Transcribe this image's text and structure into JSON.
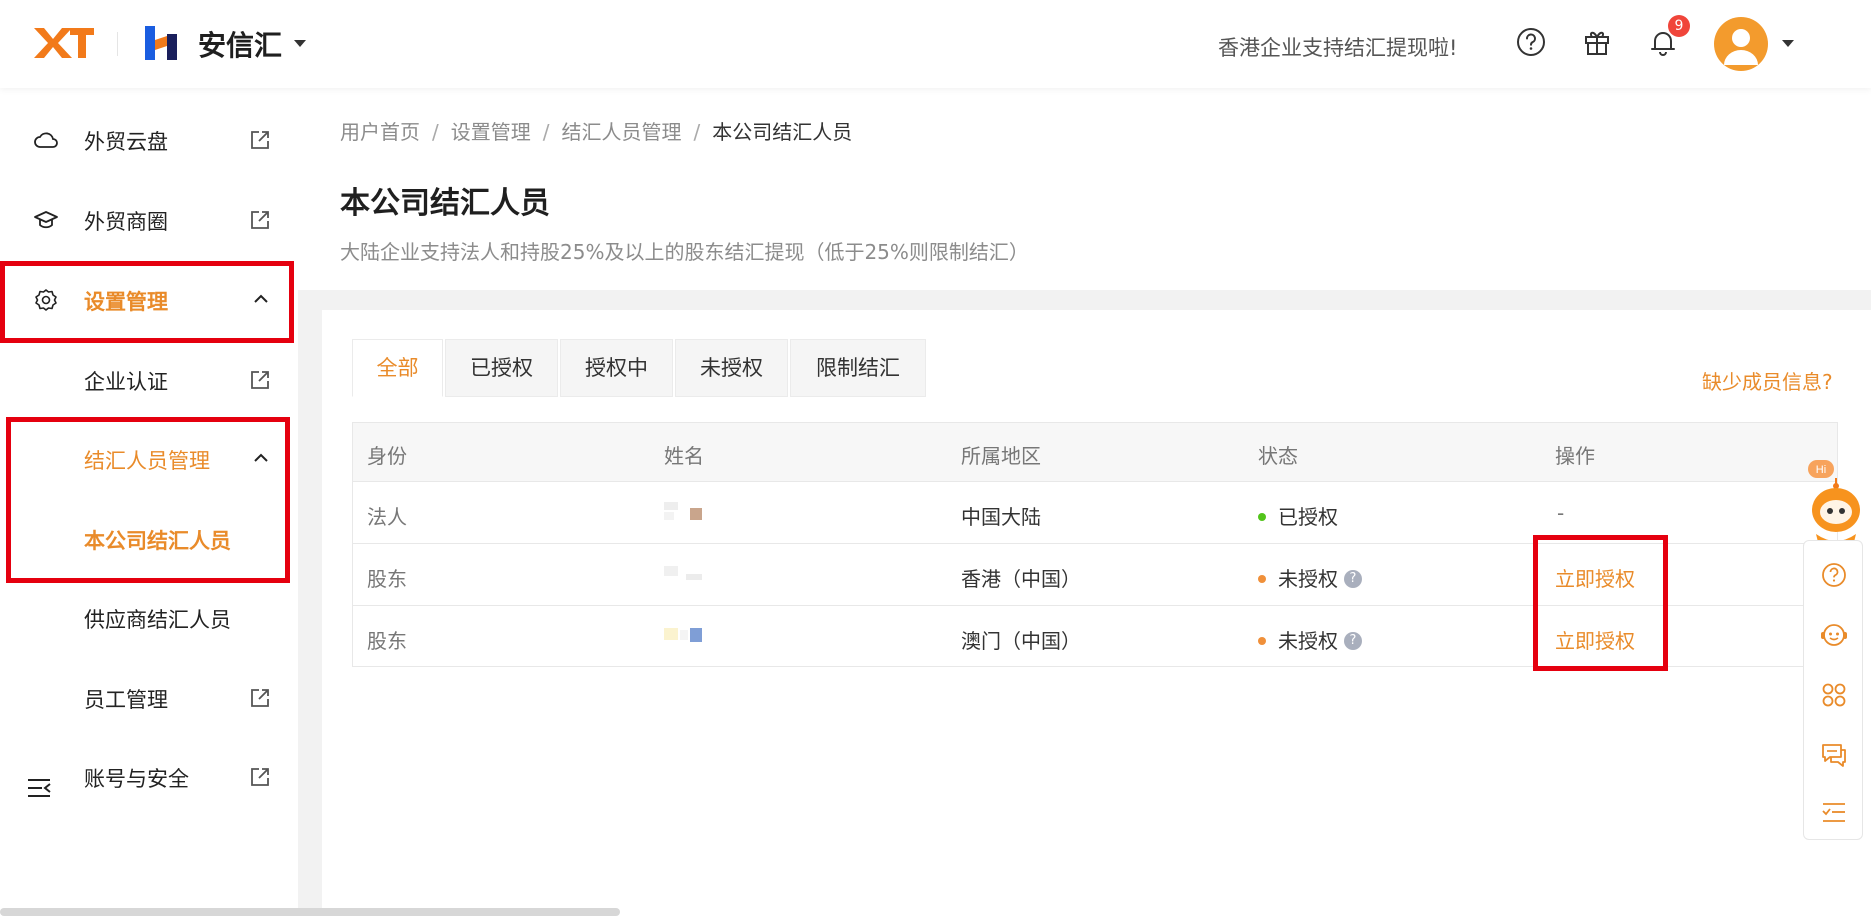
{
  "header": {
    "logo_text": "XT",
    "brand": "安信汇",
    "notice": "香港企业支持结汇提现啦!",
    "notification_count": "9",
    "icons": [
      "help-circle-icon",
      "gift-icon",
      "bell-icon",
      "avatar-icon",
      "caret-down-icon"
    ]
  },
  "sidebar": {
    "items": [
      {
        "label": "外贸云盘",
        "icon": "cloud-icon",
        "external": true
      },
      {
        "label": "外贸商圈",
        "icon": "graduation-cap-icon",
        "external": true
      },
      {
        "label": "设置管理",
        "icon": "settings-icon",
        "expanded": true
      },
      {
        "label": "企业认证",
        "external": true
      },
      {
        "label": "结汇人员管理",
        "expanded": true
      },
      {
        "label": "本公司结汇人员",
        "active": true
      },
      {
        "label": "供应商结汇人员"
      },
      {
        "label": "员工管理",
        "external": true
      },
      {
        "label": "账号与安全",
        "external": true
      }
    ],
    "collapse_icon": "menu-collapse-icon"
  },
  "breadcrumb": [
    "用户首页",
    "设置管理",
    "结汇人员管理",
    "本公司结汇人员"
  ],
  "breadcrumb_sep": "/",
  "page": {
    "title": "本公司结汇人员",
    "description": "大陆企业支持法人和持股25%及以上的股东结汇提现（低于25%则限制结汇）"
  },
  "tabs": [
    {
      "label": "全部",
      "active": true
    },
    {
      "label": "已授权"
    },
    {
      "label": "授权中"
    },
    {
      "label": "未授权"
    },
    {
      "label": "限制结汇"
    }
  ],
  "missing_info_link": "缺少成员信息?",
  "table": {
    "headers": [
      "身份",
      "姓名",
      "所属地区",
      "状态",
      "操作"
    ],
    "rows": [
      {
        "identity": "法人",
        "name": "",
        "region": "中国大陆",
        "status": "已授权",
        "status_color": "#52c41a",
        "status_help": false,
        "action": "-"
      },
      {
        "identity": "股东",
        "name": "",
        "region": "香港（中国）",
        "status": "未授权",
        "status_color": "#f0903a",
        "status_help": true,
        "action": "立即授权"
      },
      {
        "identity": "股东",
        "name": "",
        "region": "澳门（中国）",
        "status": "未授权",
        "status_color": "#f0903a",
        "status_help": true,
        "action": "立即授权"
      }
    ]
  },
  "help_mark": "?",
  "float_toolbar": {
    "robot_bubble": "Hi",
    "icons": [
      "help-icon",
      "chat-bot-icon",
      "apps-icon",
      "message-icon",
      "list-icon"
    ]
  },
  "colors": {
    "accent": "#e98b2a",
    "highlight_box": "#e5000f",
    "authorized": "#52c41a",
    "unauthorized": "#f0903a"
  }
}
